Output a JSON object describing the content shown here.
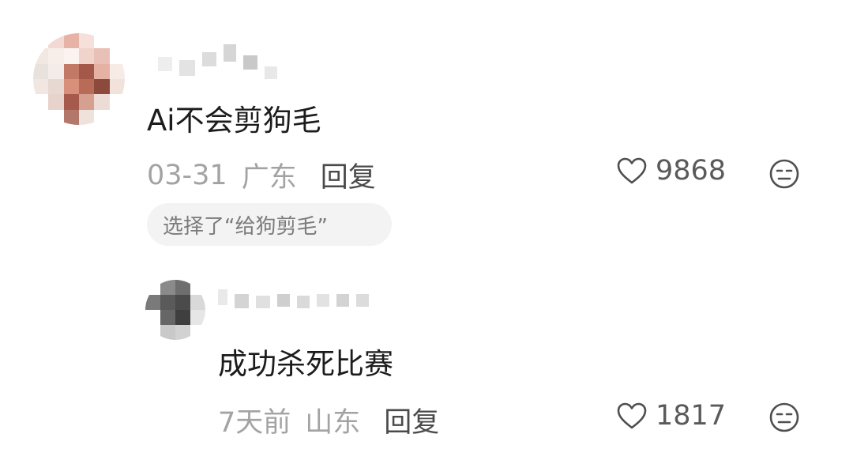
{
  "comments": [
    {
      "avatar": {
        "pixels": [
          "#ffffff",
          "#f2d9d3",
          "#e8b3a7",
          "#f6e0da",
          "#ffffff",
          "#ffffff",
          "#f3e7e2",
          "#f7eeea",
          "#fbf3ef",
          "#f0d4cc",
          "#e9c0b6",
          "#ffffff",
          "#e9e1dc",
          "#f3ece8",
          "#c27a67",
          "#a4584a",
          "#e4b1a3",
          "#f7ebe6",
          "#f1e6e1",
          "#e7d8d2",
          "#d8907a",
          "#b86c57",
          "#8c4a3c",
          "#f2e2dc",
          "#ffffff",
          "#e7d3cc",
          "#a55a4c",
          "#d5a090",
          "#eddcd5",
          "#ffffff",
          "#ffffff",
          "#ffffff",
          "#b3786a",
          "#efe2dc",
          "#ffffff",
          "#ffffff"
        ]
      },
      "text": "Ai不会剪狗毛",
      "date": "03-31",
      "location": "广东",
      "reply_label": "回复",
      "likes": "9868",
      "chip": "选择了“给狗剪毛”"
    },
    {
      "avatar": {
        "pixels": [
          "#ffffff",
          "#8a8a8a",
          "#6e6e6e",
          "#ffffff",
          "#7a7a7a",
          "#5a5a5a",
          "#4b4b4b",
          "#d9d9d9",
          "#ffffff",
          "#666666",
          "#3f3f3f",
          "#e6e6e6",
          "#ffffff",
          "#c9c9c9",
          "#d2d2d2",
          "#ffffff"
        ]
      },
      "text": "成功杀死比赛",
      "date": "7天前",
      "location": "山东",
      "reply_label": "回复",
      "likes": "1817"
    }
  ],
  "icons": {
    "like": "heart-outline-icon",
    "dislike": "unamused-face-icon"
  },
  "colors": {
    "meta_gray": "#a3a3a3",
    "reply_dark": "#4a4a4a",
    "chip_bg": "#f3f3f3",
    "icon_stroke": "#4f4f4f"
  }
}
